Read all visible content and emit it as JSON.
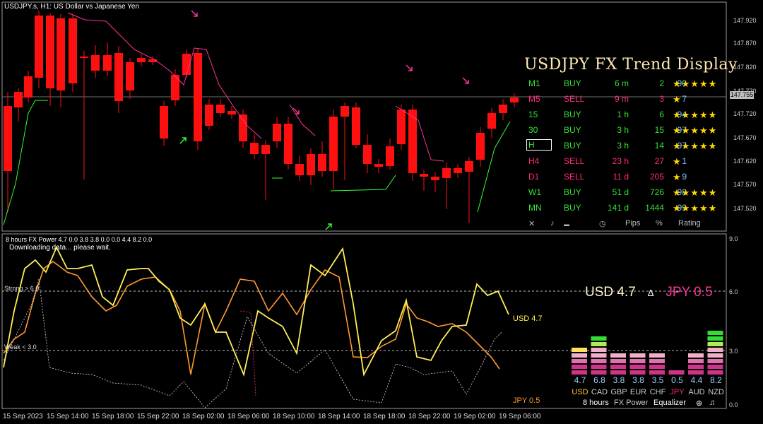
{
  "chart_header": "USDJPY.s, H1:  US Dollar vs Japanese Yen",
  "price_axis": [
    "147.920",
    "147.870",
    "147.820",
    "147.770",
    "147.720",
    "147.670",
    "147.620",
    "147.570",
    "147.520"
  ],
  "current_price": "147.755",
  "trend_display": {
    "title": "USDJPY FX Trend Display",
    "rows": [
      {
        "tf": "M1",
        "signal": "BUY",
        "time": "6 m",
        "pips": "2",
        "pct": "90",
        "stars": "★★★★★"
      },
      {
        "tf": "M5",
        "signal": "SELL",
        "time": "9 m",
        "pips": "3",
        "pct": "7",
        "stars": "★"
      },
      {
        "tf": "15",
        "signal": "BUY",
        "time": "1 h",
        "pips": "6",
        "pct": "94",
        "stars": "★★★★★"
      },
      {
        "tf": "30",
        "signal": "BUY",
        "time": "3 h",
        "pips": "15",
        "pct": "97",
        "stars": "★★★★★"
      },
      {
        "tf": "H",
        "signal": "BUY",
        "time": "3 h",
        "pips": "14",
        "pct": "97",
        "stars": "★★★★★"
      },
      {
        "tf": "H4",
        "signal": "SELL",
        "time": "23 h",
        "pips": "27",
        "pct": "1",
        "stars": "★"
      },
      {
        "tf": "D1",
        "signal": "SELL",
        "time": "11 d",
        "pips": "205",
        "pct": "9",
        "stars": "★"
      },
      {
        "tf": "W1",
        "signal": "BUY",
        "time": "51 d",
        "pips": "726",
        "pct": "98",
        "stars": "★★★★★"
      },
      {
        "tf": "MN",
        "signal": "BUY",
        "time": "141 d",
        "pips": "1444",
        "pct": "99",
        "stars": "★★★★★"
      }
    ],
    "footer": {
      "close": "✕",
      "music": "♪",
      "wave": "▬",
      "clock": "◷",
      "pips": "Pips",
      "pct": "%",
      "rating": "Rating"
    }
  },
  "oscillator": {
    "header": "8 hours FX Power 4.7 0.0 3.8 3.8 0.0 0.0 4.4 8.2 0.0",
    "status": "Downloading data... please wait.",
    "strong_label": "Strong > 6.0",
    "weak_label": "Weak < 3.0",
    "axis": [
      "9.0",
      "6.0",
      "3.0",
      "0.0"
    ],
    "usd_line_label": "USD 4.7",
    "jpy_line_label": "JPY 0.5",
    "usd_big": "USD 4.7",
    "jpy_big": "JPY 0.5",
    "delta_icon": "∆"
  },
  "equalizer": {
    "currencies": [
      {
        "name": "USD",
        "value": "4.7",
        "v": 4.7,
        "color": "#ffcc33"
      },
      {
        "name": "CAD",
        "value": "6.8",
        "v": 6.8,
        "color": "#ccc"
      },
      {
        "name": "GBP",
        "value": "3.8",
        "v": 3.8,
        "color": "#ccc"
      },
      {
        "name": "EUR",
        "value": "3.8",
        "v": 3.8,
        "color": "#ccc"
      },
      {
        "name": "CHF",
        "value": "3.5",
        "v": 3.5,
        "color": "#ccc"
      },
      {
        "name": "JPY",
        "value": "0.5",
        "v": 0.5,
        "color": "#ff2a7a"
      },
      {
        "name": "AUD",
        "value": "4.4",
        "v": 4.4,
        "color": "#ccc"
      },
      {
        "name": "NZD",
        "value": "8.2",
        "v": 8.2,
        "color": "#ccc"
      }
    ],
    "footer": {
      "period": "8 hours",
      "name": "FX Power",
      "mode": "Equalizer",
      "move": "⊕",
      "sound": "♫"
    }
  },
  "time_axis": [
    "15 Sep 2023",
    "15 Sep 14:00",
    "15 Sep 18:00",
    "15 Sep 22:00",
    "18 Sep 02:00",
    "18 Sep 06:00",
    "18 Sep 10:00",
    "18 Sep 14:00",
    "18 Sep 18:00",
    "18 Sep 22:00",
    "19 Sep 02:00",
    "19 Sep 06:00"
  ],
  "colors": {
    "bull": "#00e000",
    "bear": "#ff1010",
    "usd_line": "#ffee55",
    "jpy_line": "#ff9933",
    "sell_arrow": "#ff3399",
    "buy_arrow": "#33ff33"
  }
}
